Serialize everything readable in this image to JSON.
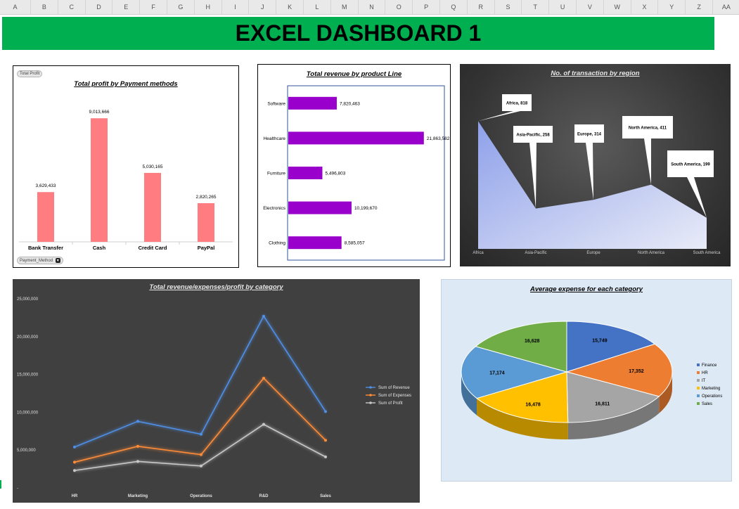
{
  "columns": [
    "A",
    "B",
    "C",
    "D",
    "E",
    "F",
    "G",
    "H",
    "I",
    "J",
    "K",
    "L",
    "M",
    "N",
    "O",
    "P",
    "Q",
    "R",
    "S",
    "T",
    "U",
    "V",
    "W",
    "X",
    "Y",
    "Z",
    "AA"
  ],
  "dashboard_title": "EXCEL DASHBOARD 1",
  "pivot_buttons": {
    "total_profit": "Total Profit",
    "payment_method": "Payment_Method"
  },
  "colors": {
    "banner": "#00b050",
    "profit_bar": "#ff7c80",
    "revenue_bar": "#9900cc",
    "area_fill": "#a6b4ee"
  },
  "chart_data": [
    {
      "type": "bar",
      "title": "Total profit by Payment methods",
      "categories": [
        "Bank Transfer",
        "Cash",
        "Credit Card",
        "PayPal"
      ],
      "values": [
        3629433,
        9013666,
        5030165,
        2820265
      ],
      "value_labels": [
        "3,629,433",
        "9,013,666",
        "5,030,165",
        "2,820,265"
      ],
      "ylim": [
        0,
        10000000
      ]
    },
    {
      "type": "bar",
      "orientation": "horizontal",
      "title": "Total revenue by product Line",
      "categories": [
        "Software",
        "Healthcare",
        "Furniture",
        "Electronics",
        "Clothing"
      ],
      "values": [
        7820463,
        21863582,
        5496803,
        10199670,
        8585057
      ],
      "value_labels": [
        "7,820,463",
        "21,863,582",
        "5,496,803",
        "10,199,670",
        "8,585,057"
      ],
      "xlim": [
        0,
        22000000
      ]
    },
    {
      "type": "area",
      "title": "No. of transaction by region",
      "categories": [
        "Africa",
        "Asia-Pacific",
        "Europe",
        "North America",
        "South America"
      ],
      "values": [
        818,
        258,
        314,
        411,
        199
      ],
      "callouts": [
        "Africa, 818",
        "Asia-Pacific, 258",
        "Europe, 314",
        "North America, 411",
        "South America, 199"
      ],
      "ylim": [
        0,
        900
      ]
    },
    {
      "type": "line",
      "title": "Total revenue/expenses/profit by category",
      "categories": [
        "HR",
        "Marketing",
        "Operations",
        "R&D",
        "Sales"
      ],
      "y_ticks": [
        "25,000,000",
        "20,000,000",
        "15,000,000",
        "10,000,000",
        "5,000,000",
        "-"
      ],
      "ylim": [
        0,
        25000000
      ],
      "legend_position": "right",
      "series": [
        {
          "name": "Sum of Revenue",
          "color": "#4f8fe6",
          "values": [
            5400000,
            8800000,
            7100000,
            22700000,
            10100000
          ]
        },
        {
          "name": "Sum of Expenses",
          "color": "#ff8c38",
          "values": [
            3400000,
            5500000,
            4400000,
            14500000,
            6300000
          ]
        },
        {
          "name": "Sum of Profit",
          "color": "#c8c8c8",
          "values": [
            2300000,
            3500000,
            2900000,
            8400000,
            4100000
          ]
        }
      ]
    },
    {
      "type": "pie",
      "title": "Average expense for each category",
      "categories": [
        "Finance",
        "HR",
        "IT",
        "Marketing",
        "Operations",
        "Sales"
      ],
      "values": [
        15749,
        17352,
        16811,
        16478,
        17174,
        16628
      ],
      "value_labels": [
        "15,749",
        "17,352",
        "16,811",
        "16,478",
        "17,174",
        "16,628"
      ],
      "slice_colors": [
        "#4472c4",
        "#ed7d31",
        "#a5a5a5",
        "#ffc000",
        "#5b9bd5",
        "#70ad47"
      ],
      "legend_position": "right"
    }
  ]
}
